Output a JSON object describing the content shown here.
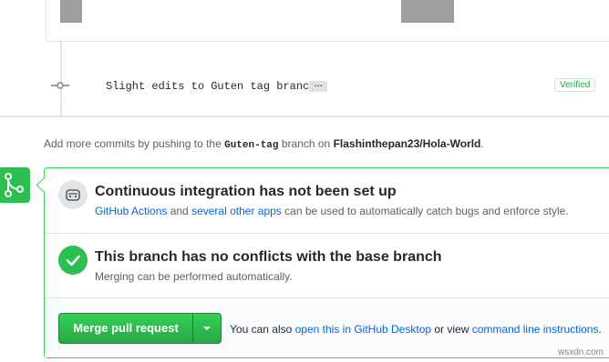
{
  "commit": {
    "message": "Slight edits to Guten tag branch",
    "ellipsis": "…",
    "verified": "Verified"
  },
  "push_note": {
    "prefix": "Add more commits by pushing to the ",
    "branch": "Guten-tag",
    "middle": " branch on ",
    "repo": "Flashinthepan23/Hola-World",
    "suffix": "."
  },
  "ci": {
    "title": "Continuous integration has not been set up",
    "link1": "GitHub Actions",
    "and": " and ",
    "link2": "several other apps",
    "rest": " can be used to automatically catch bugs and enforce style."
  },
  "conflicts": {
    "title": "This branch has no conflicts with the base branch",
    "desc": "Merging can be performed automatically."
  },
  "merge": {
    "button_label": "Merge pull request",
    "alt_prefix": "You can also ",
    "alt_link1": "open this in GitHub Desktop",
    "alt_middle": " or view ",
    "alt_link2": "command line instructions",
    "alt_suffix": "."
  },
  "watermark": "wsxdn.com",
  "colors": {
    "accent_green": "#2cbe4e",
    "link_blue": "#0366d6",
    "border_green": "#34d058"
  },
  "icons": [
    "git-merge-icon",
    "robot-icon",
    "check-icon",
    "caret-down-icon",
    "commit-icon"
  ]
}
